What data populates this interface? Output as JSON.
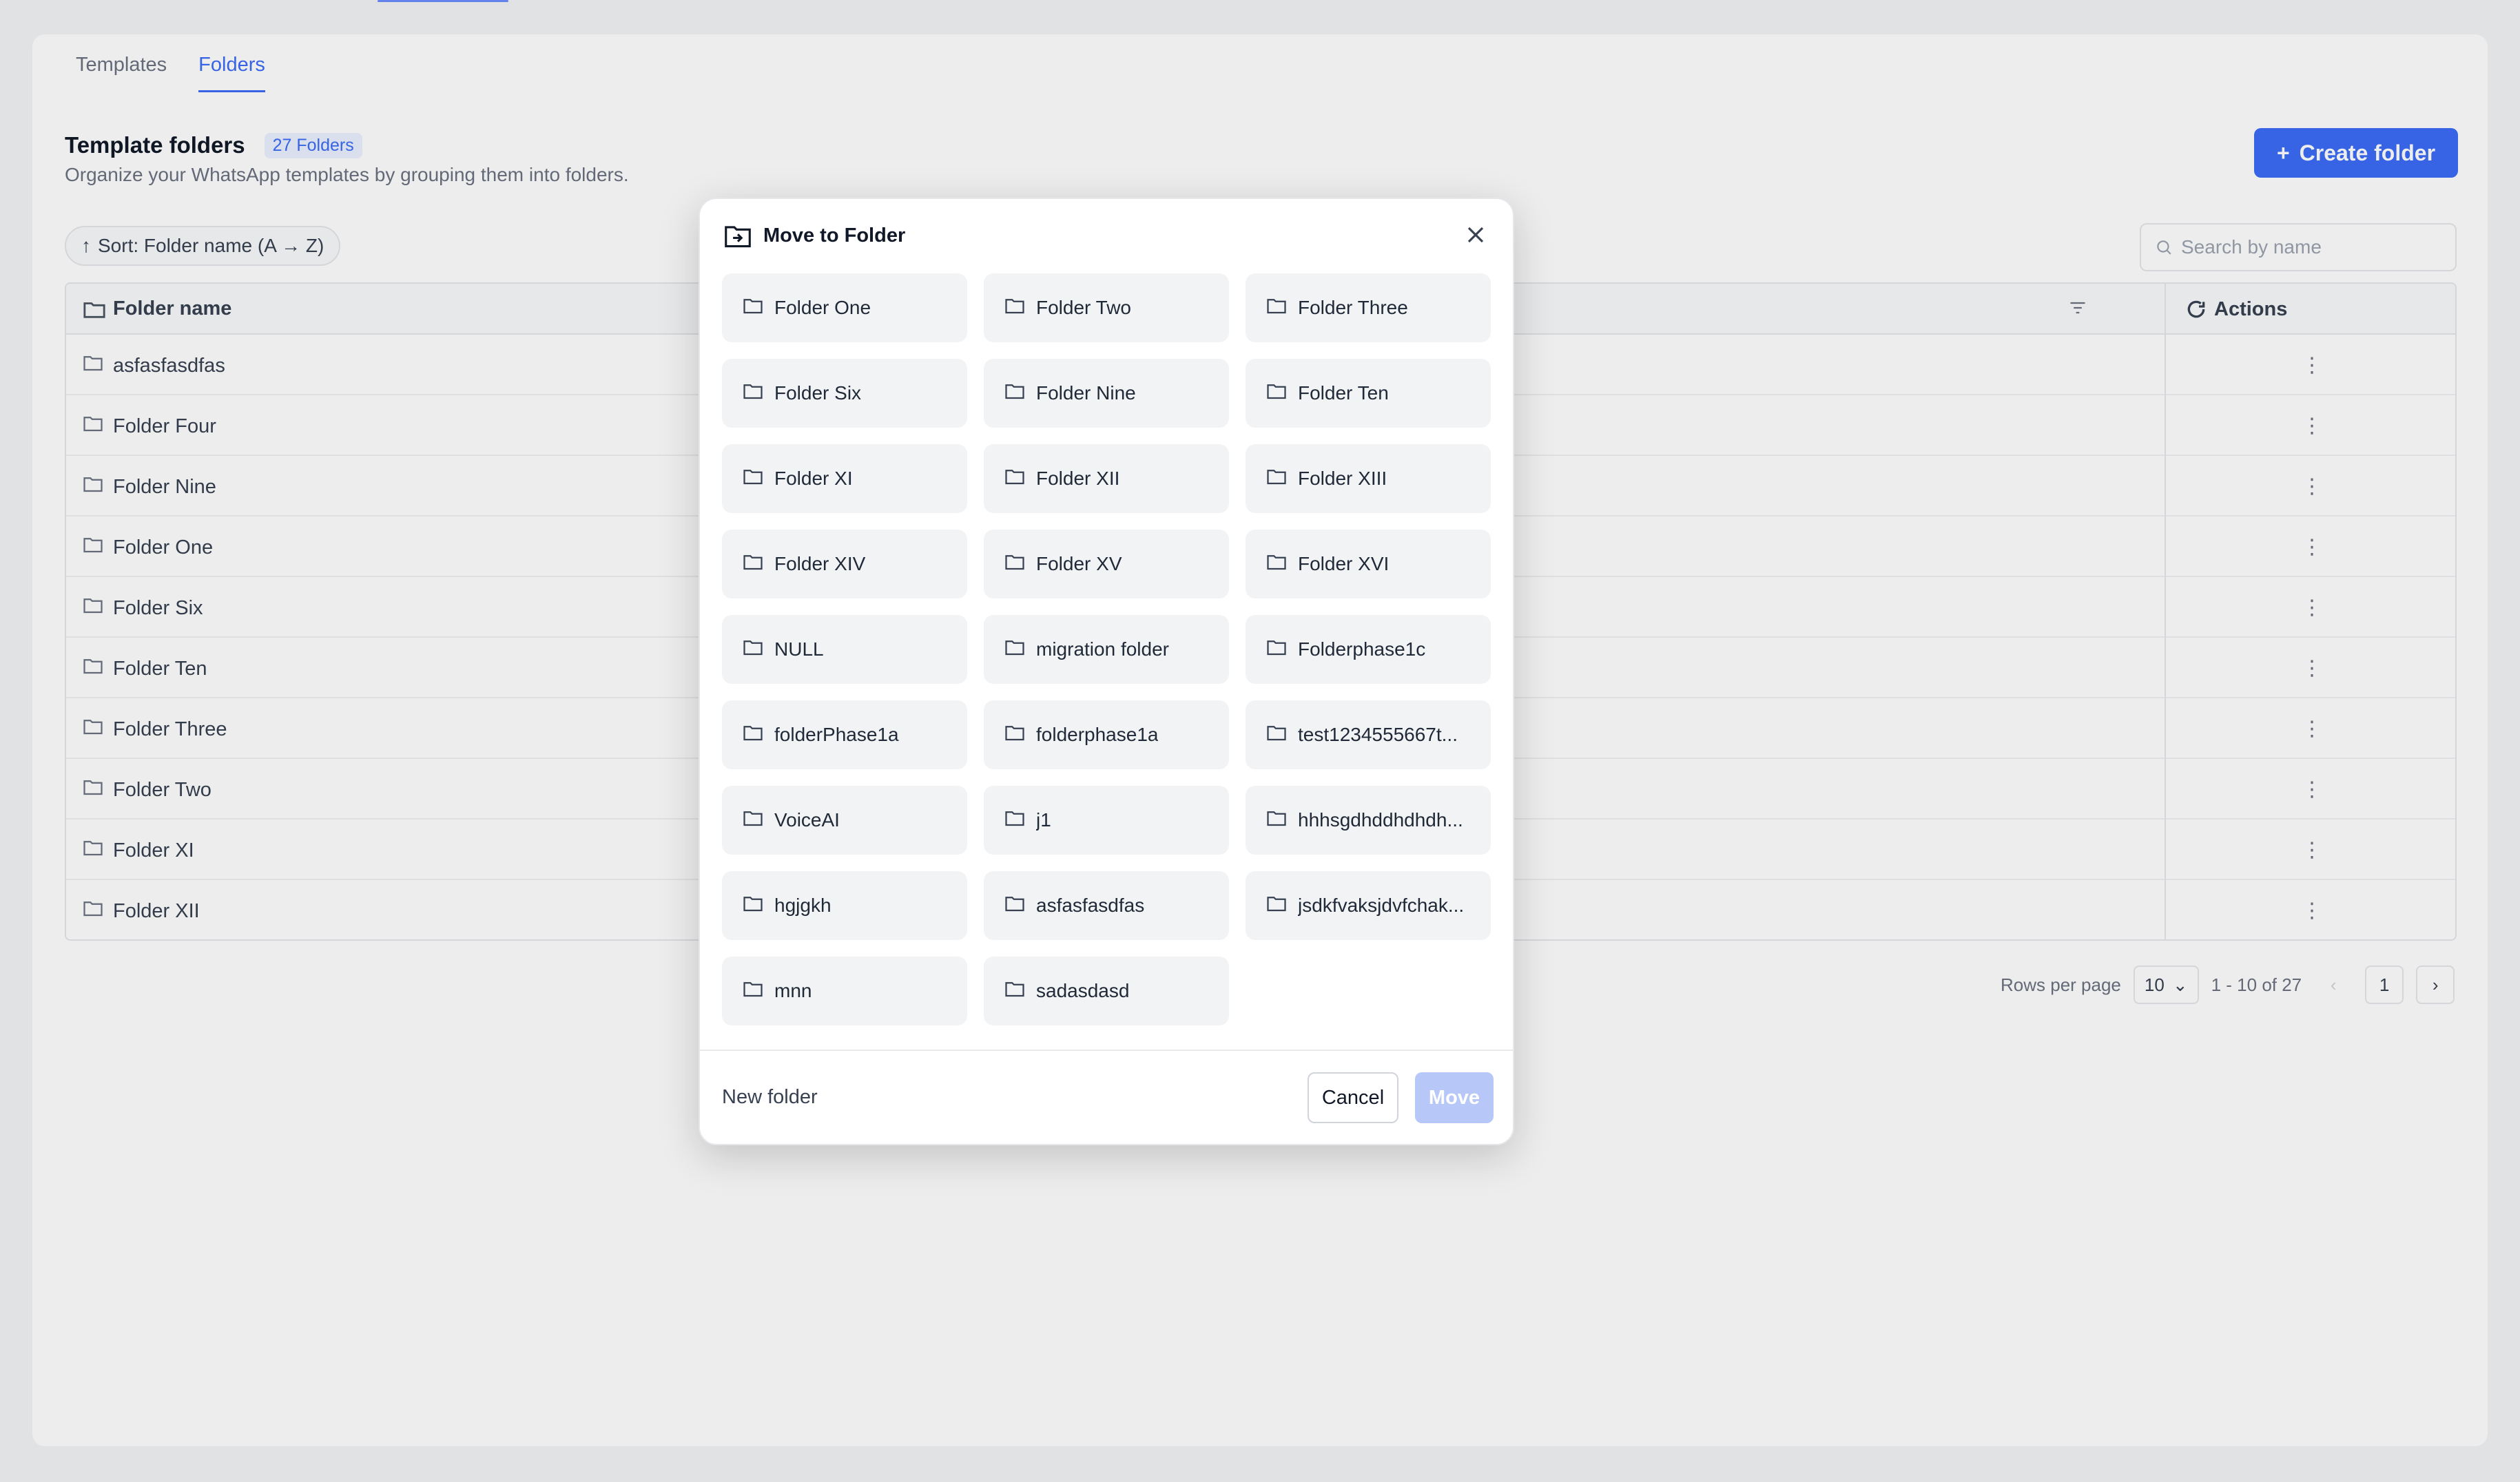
{
  "tabs": [
    "Templates",
    "Folders"
  ],
  "header": {
    "title": "Template folders",
    "count": "27 Folders",
    "subtitle": "Organize your WhatsApp templates by grouping them into folders.",
    "create_label": "Create folder"
  },
  "toolbar": {
    "sort_label": "Sort: Folder name (A → Z)",
    "search_placeholder": "Search by name"
  },
  "table": {
    "col_name": "Folder name",
    "col_actions": "Actions",
    "rows": [
      "asfasfasdfas",
      "Folder Four",
      "Folder Nine",
      "Folder One",
      "Folder Six",
      "Folder Ten",
      "Folder Three",
      "Folder Two",
      "Folder XI",
      "Folder XII"
    ]
  },
  "pagination": {
    "rows_per_page_label": "Rows per page",
    "rows_per_page": "10",
    "range": "1 - 10 of 27",
    "current_page": "1"
  },
  "modal": {
    "title": "Move to Folder",
    "folders": [
      "Folder One",
      "Folder Two",
      "Folder Three",
      "Folder Six",
      "Folder Nine",
      "Folder Ten",
      "Folder XI",
      "Folder XII",
      "Folder XIII",
      "Folder XIV",
      "Folder XV",
      "Folder XVI",
      "NULL",
      "migration folder",
      "Folderphase1c",
      "folderPhase1a",
      "folderphase1a",
      "test1234555667t...",
      "VoiceAI",
      "j1",
      "hhhsgdhddhdhdh...",
      "hgjgkh",
      "asfasfasdfas",
      "jsdkfvaksjdvfchak...",
      "mnn",
      "sadasdasd"
    ],
    "new_folder_label": "New folder",
    "cancel_label": "Cancel",
    "move_label": "Move"
  },
  "colors": {
    "accent": "#3b6cf6",
    "move_disabled": "#b7c7f7",
    "tile_bg": "#f2f3f5"
  }
}
